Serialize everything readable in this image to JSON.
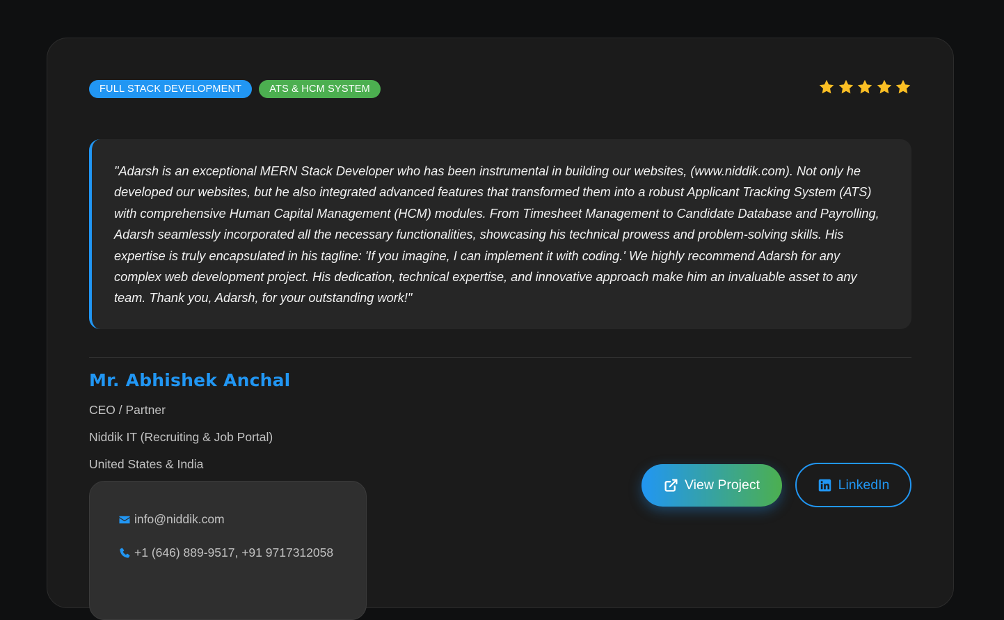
{
  "tags": [
    "FULL STACK DEVELOPMENT",
    "ATS & HCM SYSTEM"
  ],
  "rating": {
    "stars": 5,
    "max": 5,
    "color": "#fbbf24"
  },
  "testimonial": {
    "quote": "\"Adarsh is an exceptional MERN Stack Developer who has been instrumental in building our websites, (www.niddik.com). Not only he developed our websites, but he also integrated advanced features that transformed them into a robust Applicant Tracking System (ATS) with comprehensive Human Capital Management (HCM) modules. From Timesheet Management to Candidate Database and Payrolling, Adarsh seamlessly incorporated all the necessary functionalities, showcasing his technical prowess and problem-solving skills. His expertise is truly encapsulated in his tagline: 'If you imagine, I can implement it with coding.' We highly recommend Adarsh for any complex web development project. His dedication, technical expertise, and innovative approach make him an invaluable asset to any team. Thank you, Adarsh, for your outstanding work!\""
  },
  "author": {
    "name": "Mr. Abhishek Anchal",
    "role": "CEO / Partner",
    "company": "Niddik IT (Recruiting & Job Portal)",
    "location": "United States & India"
  },
  "contact": {
    "email": "info@niddik.com",
    "phone": "+1 (646) 889-9517, +91 9717312058",
    "email_icon": "envelope-icon",
    "phone_icon": "phone-icon"
  },
  "actions": {
    "view_project_label": "View Project",
    "view_project_icon": "external-link-icon",
    "linkedin_label": "LinkedIn",
    "linkedin_icon": "linkedin-icon"
  },
  "colors": {
    "accent_blue": "#2196f3",
    "accent_green": "#4caf50",
    "card_bg": "#1b1b1b",
    "page_bg": "#0f1011"
  }
}
